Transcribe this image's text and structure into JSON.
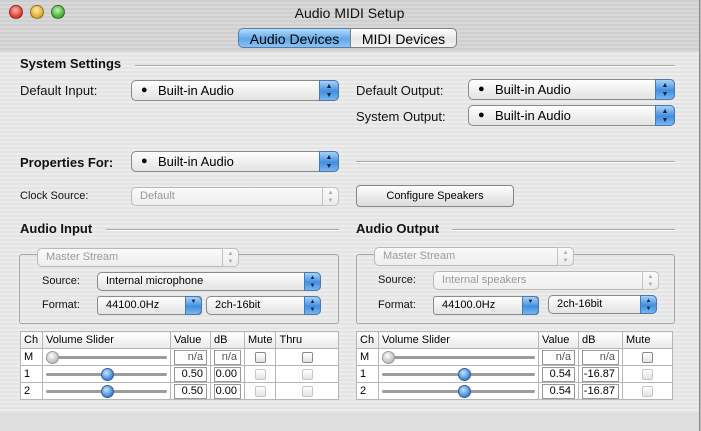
{
  "window": {
    "title": "Audio MIDI Setup"
  },
  "tabs": [
    {
      "label": "Audio Devices",
      "selected": true
    },
    {
      "label": "MIDI Devices",
      "selected": false
    }
  ],
  "system_settings": {
    "heading": "System Settings",
    "default_input_label": "Default Input:",
    "default_input_value": "Built-in Audio",
    "default_output_label": "Default Output:",
    "default_output_value": "Built-in Audio",
    "system_output_label": "System Output:",
    "system_output_value": "Built-in Audio"
  },
  "properties": {
    "label": "Properties For:",
    "value": "Built-in Audio",
    "clock_source_label": "Clock Source:",
    "clock_source_value": "Default",
    "configure_speakers": "Configure Speakers"
  },
  "audio_input": {
    "heading": "Audio Input",
    "stream": "Master Stream",
    "source_label": "Source:",
    "source_value": "Internal microphone",
    "format_label": "Format:",
    "format_rate": "44100.0Hz",
    "format_bits": "2ch-16bit",
    "columns": [
      "Ch",
      "Volume Slider",
      "Value",
      "dB",
      "Mute",
      "Thru"
    ],
    "rows": [
      {
        "ch": "M",
        "value": "n/a",
        "db": "n/a",
        "level": 0.0
      },
      {
        "ch": "1",
        "value": "0.50",
        "db": "0.00",
        "level": 0.5
      },
      {
        "ch": "2",
        "value": "0.50",
        "db": "0.00",
        "level": 0.5
      }
    ]
  },
  "audio_output": {
    "heading": "Audio Output",
    "stream": "Master Stream",
    "source_label": "Source:",
    "source_value": "Internal speakers",
    "format_label": "Format:",
    "format_rate": "44100.0Hz",
    "format_bits": "2ch-16bit",
    "columns": [
      "Ch",
      "Volume Slider",
      "Value",
      "dB",
      "Mute"
    ],
    "rows": [
      {
        "ch": "M",
        "value": "n/a",
        "db": "n/a",
        "level": 0.0
      },
      {
        "ch": "1",
        "value": "0.54",
        "db": "-16.87",
        "level": 0.54
      },
      {
        "ch": "2",
        "value": "0.54",
        "db": "-16.87",
        "level": 0.54
      }
    ]
  },
  "icons": {
    "apple": "apple-logo-icon",
    "popup_arrows": "updown-arrows-icon"
  },
  "colors": {
    "accent": "#3f8fe0",
    "close": "#e0443a",
    "minimize": "#e2b23a",
    "zoom": "#4fb541"
  }
}
